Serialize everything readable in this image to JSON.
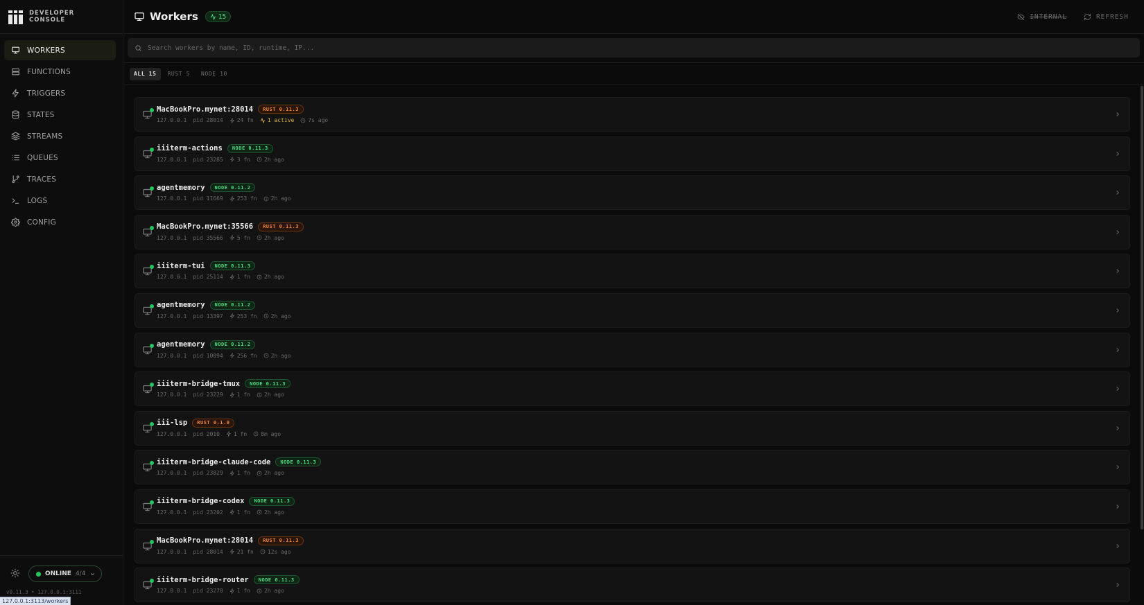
{
  "brand": {
    "line1": "DEVELOPER",
    "line2": "CONSOLE"
  },
  "nav": [
    {
      "label": "WORKERS",
      "icon": "monitor-icon",
      "active": true
    },
    {
      "label": "FUNCTIONS",
      "icon": "server-icon",
      "active": false
    },
    {
      "label": "TRIGGERS",
      "icon": "zap-icon",
      "active": false
    },
    {
      "label": "STATES",
      "icon": "database-icon",
      "active": false
    },
    {
      "label": "STREAMS",
      "icon": "layers-icon",
      "active": false
    },
    {
      "label": "QUEUES",
      "icon": "list-icon",
      "active": false
    },
    {
      "label": "TRACES",
      "icon": "git-branch-icon",
      "active": false
    },
    {
      "label": "LOGS",
      "icon": "terminal-icon",
      "active": false
    },
    {
      "label": "CONFIG",
      "icon": "gear-icon",
      "active": false
    }
  ],
  "status": {
    "label": "ONLINE",
    "count": "4/4"
  },
  "footer": {
    "version": "v0.11.3 • 127.0.0.1:3111",
    "status_url": "127.0.0.1:3113/workers"
  },
  "header": {
    "title": "Workers",
    "count": "15",
    "internal_label": "INTERNAL",
    "refresh_label": "REFRESH"
  },
  "search": {
    "placeholder": "Search workers by name, ID, runtime, IP..."
  },
  "tabs": [
    {
      "label": "ALL 15",
      "active": true
    },
    {
      "label": "RUST 5",
      "active": false
    },
    {
      "label": "NODE 10",
      "active": false
    }
  ],
  "colors": {
    "accent_green": "#22c55e",
    "node_badge": "#4ade80",
    "rust_badge": "#f0883e",
    "active_yellow": "#e3b341"
  },
  "workers": [
    {
      "name": "MacBookPro.mynet:28014",
      "runtime": "rust",
      "version": "RUST 0.11.3",
      "ip": "127.0.0.1",
      "pid": "pid 28014",
      "fn": "24 fn",
      "active": "1 active",
      "time": "7s ago"
    },
    {
      "name": "iiiterm-actions",
      "runtime": "node",
      "version": "NODE 0.11.3",
      "ip": "127.0.0.1",
      "pid": "pid 23285",
      "fn": "3 fn",
      "active": "",
      "time": "2h ago"
    },
    {
      "name": "agentmemory",
      "runtime": "node",
      "version": "NODE 0.11.2",
      "ip": "127.0.0.1",
      "pid": "pid 11669",
      "fn": "253 fn",
      "active": "",
      "time": "2h ago"
    },
    {
      "name": "MacBookPro.mynet:35566",
      "runtime": "rust",
      "version": "RUST 0.11.3",
      "ip": "127.0.0.1",
      "pid": "pid 35566",
      "fn": "5 fn",
      "active": "",
      "time": "2h ago"
    },
    {
      "name": "iiiterm-tui",
      "runtime": "node",
      "version": "NODE 0.11.3",
      "ip": "127.0.0.1",
      "pid": "pid 25114",
      "fn": "1 fn",
      "active": "",
      "time": "2h ago"
    },
    {
      "name": "agentmemory",
      "runtime": "node",
      "version": "NODE 0.11.2",
      "ip": "127.0.0.1",
      "pid": "pid 13397",
      "fn": "253 fn",
      "active": "",
      "time": "2h ago"
    },
    {
      "name": "agentmemory",
      "runtime": "node",
      "version": "NODE 0.11.2",
      "ip": "127.0.0.1",
      "pid": "pid 10094",
      "fn": "256 fn",
      "active": "",
      "time": "2h ago"
    },
    {
      "name": "iiiterm-bridge-tmux",
      "runtime": "node",
      "version": "NODE 0.11.3",
      "ip": "127.0.0.1",
      "pid": "pid 23229",
      "fn": "1 fn",
      "active": "",
      "time": "2h ago"
    },
    {
      "name": "iii-lsp",
      "runtime": "rust",
      "version": "RUST 0.1.0",
      "ip": "127.0.0.1",
      "pid": "pid 2010",
      "fn": "1 fn",
      "active": "",
      "time": "8m ago"
    },
    {
      "name": "iiiterm-bridge-claude-code",
      "runtime": "node",
      "version": "NODE 0.11.3",
      "ip": "127.0.0.1",
      "pid": "pid 23829",
      "fn": "1 fn",
      "active": "",
      "time": "2h ago"
    },
    {
      "name": "iiiterm-bridge-codex",
      "runtime": "node",
      "version": "NODE 0.11.3",
      "ip": "127.0.0.1",
      "pid": "pid 23202",
      "fn": "1 fn",
      "active": "",
      "time": "2h ago"
    },
    {
      "name": "MacBookPro.mynet:28014",
      "runtime": "rust",
      "version": "RUST 0.11.3",
      "ip": "127.0.0.1",
      "pid": "pid 28014",
      "fn": "21 fn",
      "active": "",
      "time": "12s ago"
    },
    {
      "name": "iiiterm-bridge-router",
      "runtime": "node",
      "version": "NODE 0.11.3",
      "ip": "127.0.0.1",
      "pid": "pid 23270",
      "fn": "1 fn",
      "active": "",
      "time": "2h ago"
    }
  ]
}
